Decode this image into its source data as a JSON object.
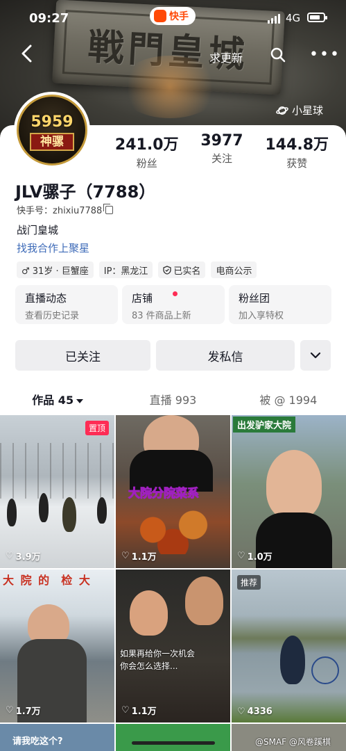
{
  "status": {
    "time": "09:27",
    "app": "快手",
    "network": "4G"
  },
  "nav": {
    "update": "求更新",
    "planet": "小星球"
  },
  "banner": {
    "plaque_text": "戦門皇城"
  },
  "avatar": {
    "number": "5959",
    "name": "神骡"
  },
  "stats": [
    {
      "num": "241.0万",
      "label": "粉丝"
    },
    {
      "num": "3977",
      "label": "关注"
    },
    {
      "num": "144.8万",
      "label": "获赞"
    }
  ],
  "profile": {
    "name": "JLV骡子（7788）",
    "id": "快手号：zhixiu7788",
    "bio": "战门皇城",
    "coop": "找我合作上聚星"
  },
  "tags": [
    "♂ 31岁 · 巨蟹座",
    "IP：黑龙江",
    "已实名",
    "电商公示"
  ],
  "features": [
    {
      "title": "直播动态",
      "sub": "查看历史记录"
    },
    {
      "title": "店铺",
      "sub": "83 件商品上新"
    },
    {
      "title": "粉丝团",
      "sub": "加入享特权"
    }
  ],
  "actions": {
    "follow": "已关注",
    "message": "发私信"
  },
  "tabs": [
    {
      "label": "作品 45"
    },
    {
      "label": "直播 993"
    },
    {
      "label": "被 @ 1994"
    }
  ],
  "videos": [
    {
      "likes": "3.9万",
      "badge": "置顶"
    },
    {
      "likes": "1.1万",
      "caption": "大院分院菜系"
    },
    {
      "likes": "1.0万",
      "caption": "出发驴家大院"
    },
    {
      "likes": "1.7万",
      "caption": "大 院 的  检 大"
    },
    {
      "likes": "1.1万",
      "caption": "如果再给你一次机会\n你会怎么选择..."
    },
    {
      "likes": "4336",
      "badge": "推荐"
    }
  ],
  "bottom": {
    "caption": "请我吃这个?",
    "watermark": "@SMAF @风卷蹊棋"
  }
}
